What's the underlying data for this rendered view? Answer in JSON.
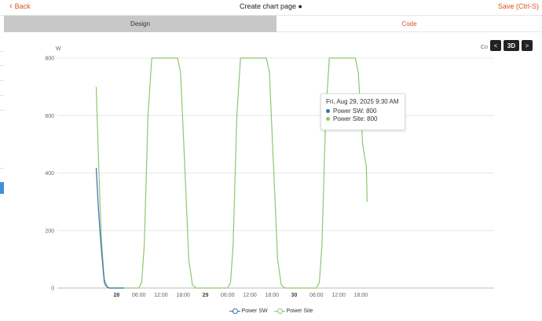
{
  "topbar": {
    "back_label": "Back",
    "title": "Create chart page ●",
    "save_label": "Save (Ctrl-S)"
  },
  "tabs": [
    {
      "label": "Design",
      "active": false
    },
    {
      "label": "Code",
      "active": true
    }
  ],
  "chart_controls": {
    "prev_icon": "chevron-left-icon",
    "next_icon": "chevron-right-icon",
    "prev_label": "<",
    "next_label": ">",
    "three_d_label": "3D",
    "corner_text": "Co"
  },
  "tooltip": {
    "time": "Fri, Aug 29, 2025 9:30 AM",
    "rows": [
      {
        "series": "Power SW",
        "label": "Power SW: 800"
      },
      {
        "series": "Power Site",
        "label": "Power Site: 800"
      }
    ]
  },
  "chart_data": {
    "type": "line",
    "ylabel": "W",
    "ylim": [
      0,
      800
    ],
    "yticks": [
      0,
      200,
      400,
      600,
      800
    ],
    "xlim_hours": [
      -16,
      102
    ],
    "x_ticks": [
      {
        "label": "28",
        "hour": 0,
        "bold": true
      },
      {
        "label": "06:00",
        "hour": 6
      },
      {
        "label": "12:00",
        "hour": 12
      },
      {
        "label": "18:00",
        "hour": 18
      },
      {
        "label": "29",
        "hour": 24,
        "bold": true
      },
      {
        "label": "06:00",
        "hour": 30
      },
      {
        "label": "12:00",
        "hour": 36
      },
      {
        "label": "18:00",
        "hour": 42
      },
      {
        "label": "30",
        "hour": 48,
        "bold": true
      },
      {
        "label": "06:00",
        "hour": 54
      },
      {
        "label": "12:00",
        "hour": 60
      },
      {
        "label": "18:00",
        "hour": 66
      }
    ],
    "grid": true,
    "legend_position": "bottom-center",
    "series": [
      {
        "name": "Power SW",
        "color": "#3c6ab0",
        "points": [
          [
            -5.5,
            418
          ],
          [
            -5.0,
            300
          ],
          [
            -4.5,
            200
          ],
          [
            -4.0,
            120
          ],
          [
            -3.3,
            20
          ],
          [
            -3.0,
            10
          ],
          [
            -2.5,
            3
          ],
          [
            -2.0,
            0
          ],
          [
            2.0,
            0
          ]
        ]
      },
      {
        "name": "Power Site",
        "color": "#8cc770",
        "points": [
          [
            -5.5,
            700
          ],
          [
            -5.0,
            500
          ],
          [
            -4.5,
            300
          ],
          [
            -4.0,
            150
          ],
          [
            -3.3,
            30
          ],
          [
            -2.5,
            5
          ],
          [
            -2.0,
            0
          ],
          [
            6.0,
            0
          ],
          [
            6.8,
            20
          ],
          [
            7.5,
            150
          ],
          [
            8.5,
            600
          ],
          [
            9.5,
            800
          ],
          [
            16.5,
            800
          ],
          [
            17.3,
            750
          ],
          [
            18.5,
            400
          ],
          [
            19.5,
            100
          ],
          [
            20.5,
            10
          ],
          [
            21.5,
            0
          ],
          [
            30.0,
            0
          ],
          [
            30.8,
            20
          ],
          [
            31.5,
            150
          ],
          [
            32.5,
            600
          ],
          [
            33.5,
            800
          ],
          [
            40.5,
            800
          ],
          [
            41.3,
            750
          ],
          [
            42.5,
            400
          ],
          [
            43.5,
            100
          ],
          [
            44.5,
            10
          ],
          [
            45.5,
            0
          ],
          [
            54.0,
            0
          ],
          [
            54.8,
            20
          ],
          [
            55.5,
            150
          ],
          [
            56.5,
            600
          ],
          [
            57.5,
            800
          ],
          [
            64.5,
            800
          ],
          [
            65.3,
            750
          ],
          [
            66.5,
            500
          ],
          [
            67.5,
            420
          ],
          [
            67.7,
            300
          ]
        ]
      }
    ]
  },
  "legend": [
    {
      "name": "Power SW",
      "color": "#3c6ab0"
    },
    {
      "name": "Power Site",
      "color": "#8cc770"
    }
  ]
}
